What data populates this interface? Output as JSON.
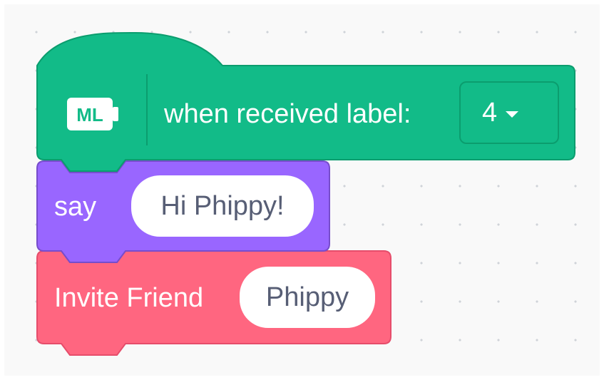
{
  "colors": {
    "ml_extension": "#12bb88",
    "ml_extension_border": "#0b9d6e",
    "looks": "#9966ff",
    "looks_border": "#774dcb",
    "custom": "#ff6680",
    "custom_border": "#e64d6b",
    "workspace": "#f9f9f9",
    "input_text": "#575e75"
  },
  "hat_block": {
    "icon": "ml-extension-icon",
    "icon_text": "ML",
    "label": "when received label:",
    "dropdown_value": "4"
  },
  "say_block": {
    "label": "say",
    "input_value": "Hi Phippy!"
  },
  "invite_block": {
    "label": "Invite Friend",
    "input_value": "Phippy"
  }
}
